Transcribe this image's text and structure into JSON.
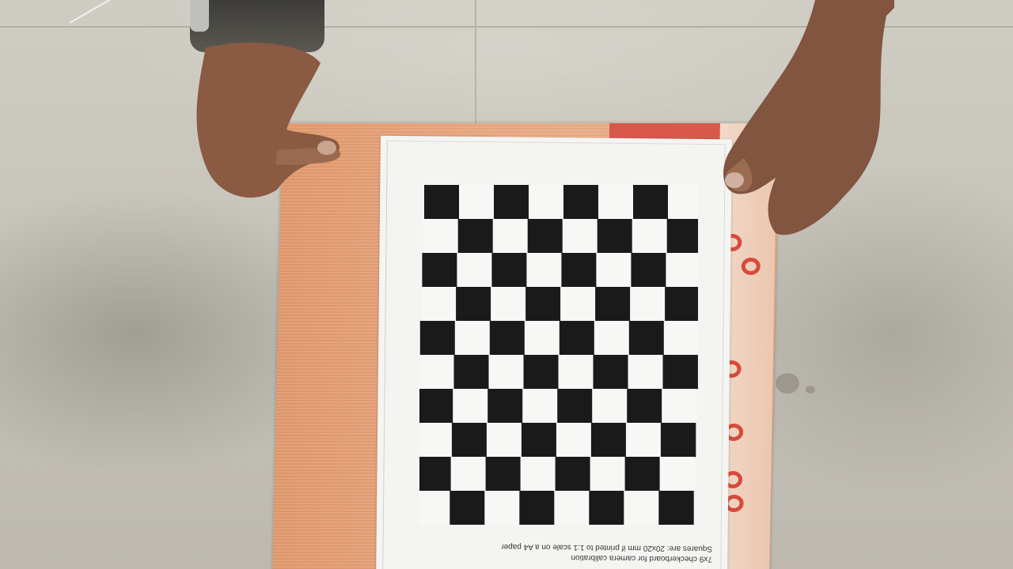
{
  "scene": {
    "description_visible": false,
    "paper_caption": {
      "line1": "7x9 checkerboard for camera calibration",
      "line2": "Squares are: 20x20 mm if printed to 1:1 scale on a A4 paper"
    },
    "checkerboard": {
      "columns": 8,
      "rows": 10,
      "dark_color": "#1a1a1a",
      "light_color": "#f7f7f5"
    }
  }
}
